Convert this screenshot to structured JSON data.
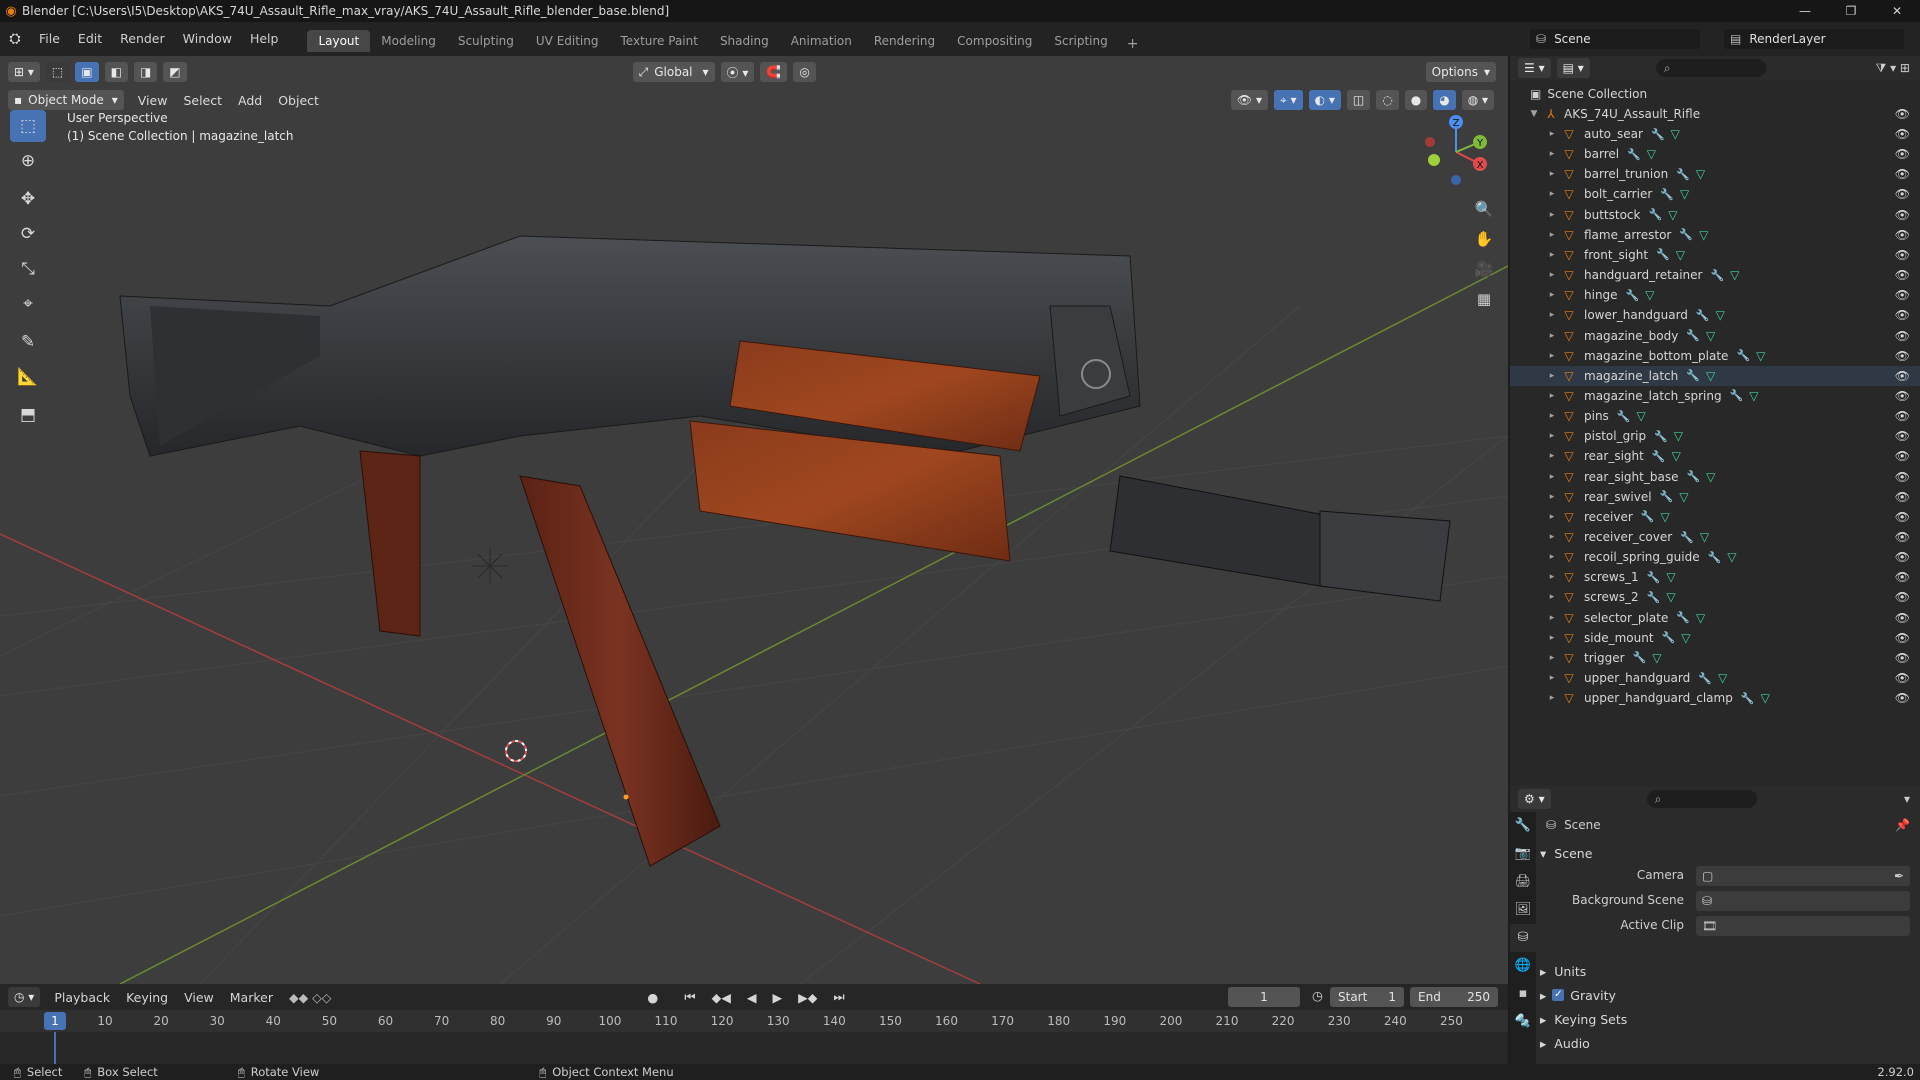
{
  "window": {
    "title": "Blender [C:\\Users\\I5\\Desktop\\AKS_74U_Assault_Rifle_max_vray/AKS_74U_Assault_Rifle_blender_base.blend]",
    "controls": [
      "—",
      "❐",
      "✕"
    ]
  },
  "menubar": {
    "items": [
      "File",
      "Edit",
      "Render",
      "Window",
      "Help"
    ],
    "workspaces": [
      "Layout",
      "Modeling",
      "Sculpting",
      "UV Editing",
      "Texture Paint",
      "Shading",
      "Animation",
      "Rendering",
      "Compositing",
      "Scripting"
    ],
    "active_workspace": "Layout",
    "scene_name": "Scene",
    "view_layer": "RenderLayer"
  },
  "viewport": {
    "transform_orientation": "Global",
    "options_label": "Options",
    "mode": "Object Mode",
    "menus": [
      "View",
      "Select",
      "Add",
      "Object"
    ],
    "perspective_label": "User Perspective",
    "context_label": "(1) Scene Collection | magazine_latch",
    "gizmo_axes": {
      "x": "X",
      "y": "Y",
      "z": "Z"
    }
  },
  "timeline": {
    "menus": [
      "Playback",
      "Keying",
      "View",
      "Marker"
    ],
    "current_frame": "1",
    "start_label": "Start",
    "start_value": "1",
    "end_label": "End",
    "end_value": "250",
    "ticks": [
      "10",
      "20",
      "30",
      "40",
      "50",
      "60",
      "70",
      "80",
      "90",
      "100",
      "110",
      "120",
      "130",
      "140",
      "150",
      "160",
      "170",
      "180",
      "190",
      "200",
      "210",
      "220",
      "230",
      "240",
      "250"
    ],
    "frame_marker": "1"
  },
  "statusbar": {
    "select": "Select",
    "box_select": "Box Select",
    "rotate": "Rotate View",
    "context_menu": "Object Context Menu",
    "version": "2.92.0"
  },
  "outliner": {
    "root": "Scene Collection",
    "collection": "AKS_74U_Assault_Rifle",
    "objects": [
      "auto_sear",
      "barrel",
      "barrel_trunion",
      "bolt_carrier",
      "buttstock",
      "flame_arrestor",
      "front_sight",
      "handguard_retainer",
      "hinge",
      "lower_handguard",
      "magazine_body",
      "magazine_bottom_plate",
      "magazine_latch",
      "magazine_latch_spring",
      "pins",
      "pistol_grip",
      "rear_sight",
      "rear_sight_base",
      "rear_swivel",
      "receiver",
      "receiver_cover",
      "recoil_spring_guide",
      "screws_1",
      "screws_2",
      "selector_plate",
      "side_mount",
      "trigger",
      "upper_handguard",
      "upper_handguard_clamp"
    ],
    "selected": "magazine_latch"
  },
  "properties": {
    "context": "Scene",
    "panel": "Scene",
    "camera_label": "Camera",
    "background_label": "Background Scene",
    "clip_label": "Active Clip",
    "subpanels": [
      "Units",
      "Gravity",
      "Keying Sets",
      "Audio"
    ]
  }
}
